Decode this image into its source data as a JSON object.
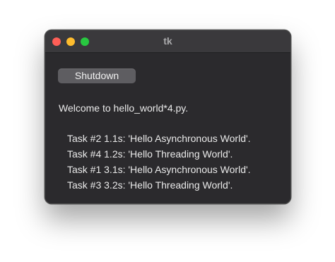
{
  "window": {
    "title": "tk"
  },
  "controls": {
    "shutdown_label": "Shutdown"
  },
  "welcome_text": "Welcome to hello_world*4.py.",
  "tasks": [
    "Task #2 1.1s: 'Hello Asynchronous World'.",
    "Task #4 1.2s: 'Hello Threading World'.",
    "Task #1 3.1s: 'Hello Asynchronous World'.",
    "Task #3 3.2s: 'Hello Threading World'."
  ],
  "colors": {
    "close": "#ff5f57",
    "minimize": "#febc2e",
    "maximize": "#28c840",
    "window_bg": "#2b2a2d",
    "button_bg": "#5e5d61"
  }
}
